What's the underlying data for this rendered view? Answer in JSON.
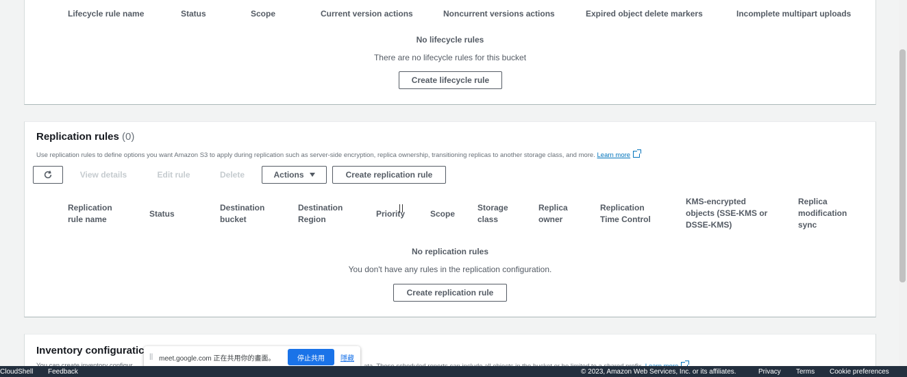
{
  "lifecycle": {
    "columns": [
      "Lifecycle rule name",
      "Status",
      "Scope",
      "Current version actions",
      "Noncurrent versions actions",
      "Expired object delete markers",
      "Incomplete multipart uploads"
    ],
    "empty_title": "No lifecycle rules",
    "empty_sub": "There are no lifecycle rules for this bucket",
    "create_button": "Create lifecycle rule"
  },
  "replication": {
    "title": "Replication rules",
    "count": "(0)",
    "description": "Use replication rules to define options you want Amazon S3 to apply during replication such as server-side encryption, replica ownership, transitioning replicas to another storage class, and more.",
    "learn_more": "Learn more",
    "toolbar": {
      "view_details": "View details",
      "edit_rule": "Edit rule",
      "delete": "Delete",
      "actions": "Actions",
      "create": "Create replication rule"
    },
    "columns": {
      "rule_name": [
        "Replication",
        "rule name"
      ],
      "status": "Status",
      "dest_bucket": [
        "Destination",
        "bucket"
      ],
      "dest_region": [
        "Destination",
        "Region"
      ],
      "priority": "Priority",
      "scope": "Scope",
      "storage_class": [
        "Storage",
        "class"
      ],
      "replica_owner": [
        "Replica",
        "owner"
      ],
      "rtc": [
        "Replication",
        "Time Control"
      ],
      "kms": [
        "KMS-encrypted",
        "objects (SSE-KMS or",
        "DSSE-KMS)"
      ],
      "replica_sync": [
        "Replica",
        "modification",
        "sync"
      ]
    },
    "empty_title": "No replication rules",
    "empty_sub": "You don't have any rules in the replication configuration.",
    "create_button": "Create replication rule"
  },
  "inventory": {
    "title": "Inventory configuratic",
    "desc_left": "You can create inventory configur",
    "desc_right": "ata. These scheduled reports can include all objects in the bucket or be limited to a shared prefix.",
    "learn_more": "Learn more"
  },
  "share_bar": {
    "pause_glyph": "||",
    "message": "meet.google.com 正在共用你的畫面。",
    "stop_button": "停止共用",
    "hide_link": "隱藏"
  },
  "footer": {
    "cloudshell": "CloudShell",
    "feedback": "Feedback",
    "copyright": "© 2023, Amazon Web Services, Inc. or its affiliates.",
    "privacy": "Privacy",
    "terms": "Terms",
    "cookie": "Cookie preferences"
  }
}
